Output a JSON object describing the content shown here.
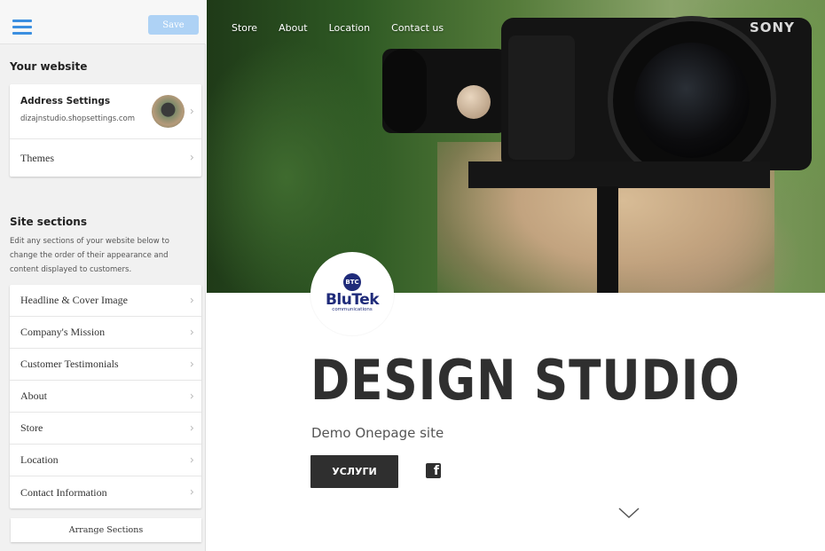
{
  "topbar": {
    "save_label": "Save"
  },
  "sidebar": {
    "your_website_title": "Your website",
    "address": {
      "title": "Address Settings",
      "url": "dizajnstudio.shopsettings.com"
    },
    "themes_label": "Themes",
    "site_sections_title": "Site sections",
    "site_sections_desc": "Edit any sections of your website below to change the order of their appearance and content displayed to customers.",
    "sections": [
      "Headline & Cover Image",
      "Company's Mission",
      "Customer Testimonials",
      "About",
      "Store",
      "Location",
      "Contact Information"
    ],
    "arrange_label": "Arrange Sections"
  },
  "preview": {
    "nav": [
      "Store",
      "About",
      "Location",
      "Contact us"
    ],
    "camera_brand": "SONY",
    "logo": {
      "mark": "BTC",
      "name": "BluTek",
      "tagline": "communications"
    },
    "headline": "DESIGN STUDIO",
    "subline": "Demo Onepage site",
    "cta_label": "УСЛУГИ",
    "facebook_icon_glyph": "f"
  },
  "colors": {
    "accent": "#3b8fe0",
    "save_button": "#aed2f5",
    "cta_background": "#2f2f2f",
    "logo_brand": "#1f2b7a",
    "sidebar_background": "#f1f1f1"
  },
  "icons": {
    "menu": "hamburger-icon",
    "chevron": "chevron-right-icon",
    "facebook": "facebook-icon",
    "scroll": "chevron-down-icon"
  }
}
